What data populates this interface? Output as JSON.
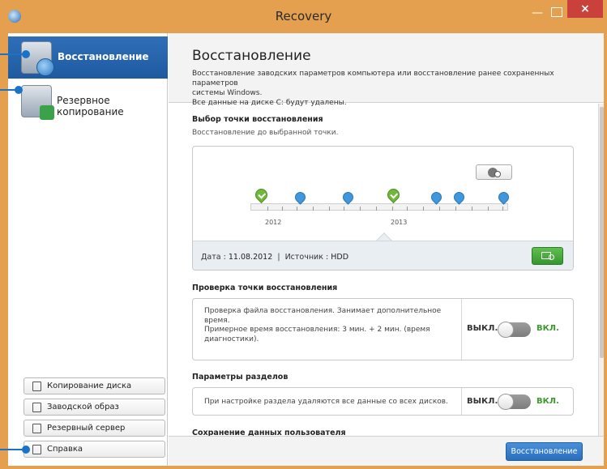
{
  "window": {
    "title": "Recovery",
    "minimize_glyph": "—",
    "close_glyph": "×"
  },
  "sidebar": {
    "items": [
      {
        "label": "Восстановление",
        "icon": "restore-icon",
        "active": true
      },
      {
        "label": "Резервное копирование",
        "icon": "backup-icon",
        "active": false
      }
    ],
    "buttons": [
      {
        "label": "Копирование диска",
        "icon": "copy-disk-icon"
      },
      {
        "label": "Заводской образ",
        "icon": "factory-image-icon"
      },
      {
        "label": "Резервный сервер",
        "icon": "backup-server-icon"
      },
      {
        "label": "Справка",
        "icon": "help-icon"
      }
    ]
  },
  "header": {
    "title": "Восстановление",
    "description_line1": "Восстановление заводских параметров компьютера или восстановление ранее сохраненных параметров",
    "description_line2": "системы Windows.",
    "description_line3": "Все данные на диске C: будут удалены."
  },
  "restore_point": {
    "title": "Выбор точки восстановления",
    "subtitle": "Восстановление до выбранной точки.",
    "years": [
      "2012",
      "2013"
    ],
    "date_label": "Дата :",
    "date_value": "11.08.2012",
    "separator": "|",
    "source_label": "Источник :",
    "source_value": "HDD"
  },
  "check_section": {
    "title": "Проверка точки восстановления",
    "text_line1": "Проверка файла восстановления. Занимает дополнительное",
    "text_line2": "время.",
    "text_line3": "Примерное время восстановления: 3 мин. + 2 мин. (время",
    "text_line4": "диагностики).",
    "off_label": "ВЫКЛ.",
    "on_label": "ВКЛ."
  },
  "partition_section": {
    "title": "Параметры разделов",
    "text": "При настройке раздела удаляются все данные со всех дисков.",
    "off_label": "ВЫКЛ.",
    "on_label": "ВКЛ."
  },
  "user_data_section": {
    "title": "Сохранение данных пользователя"
  },
  "footer": {
    "primary_label": "Восстановление"
  },
  "colors": {
    "frame": "#e4a04f",
    "accent_blue": "#2f6fb8",
    "accent_green": "#3a9a2a",
    "close_red": "#c9413a"
  }
}
